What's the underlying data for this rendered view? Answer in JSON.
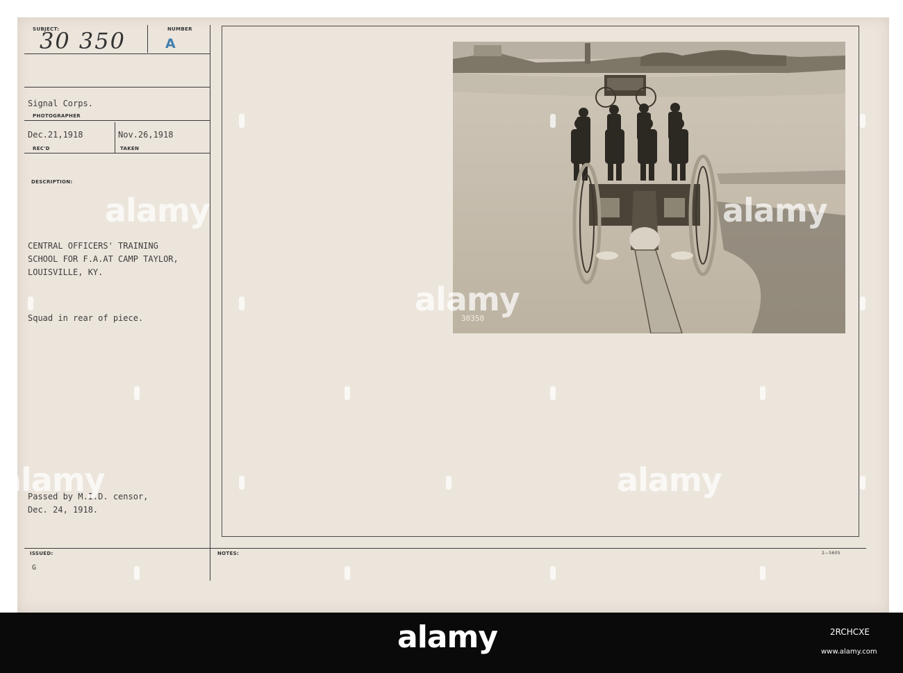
{
  "card": {
    "subject_label": "SUBJECT:",
    "subject_value": "30 350",
    "number_label": "NUMBER",
    "number_value": "A",
    "photographer_value": "Signal Corps.",
    "photographer_label": "PHOTOGRAPHER",
    "received_value": "Dec.21,1918",
    "received_label": "REC'D",
    "taken_value": "Nov.26,1918",
    "taken_label": "TAKEN",
    "description_label": "DESCRIPTION:",
    "description_lines": [
      "CENTRAL OFFICERS' TRAINING",
      "SCHOOL FOR F.A.AT CAMP TAYLOR,",
      "LOUISVILLE, KY."
    ],
    "caption": "Squad in rear of piece.",
    "censor_lines": [
      "Passed by M.I.D. censor,",
      "Dec. 24, 1918."
    ],
    "issued_label": "ISSUED:",
    "issued_value": "G",
    "notes_label": "NOTES:",
    "form_number": "2—5605",
    "photo_number": "30350"
  },
  "watermark": {
    "text": "alamy"
  },
  "footer": {
    "brand": "alamy",
    "image_id": "2RCHCXE",
    "site": "www.alamy.com"
  },
  "colors": {
    "card": "#ece5dc",
    "ink": "#3c3c3c",
    "stamp_blue": "#3f7fae",
    "footer_bg": "#0a0a0a"
  }
}
